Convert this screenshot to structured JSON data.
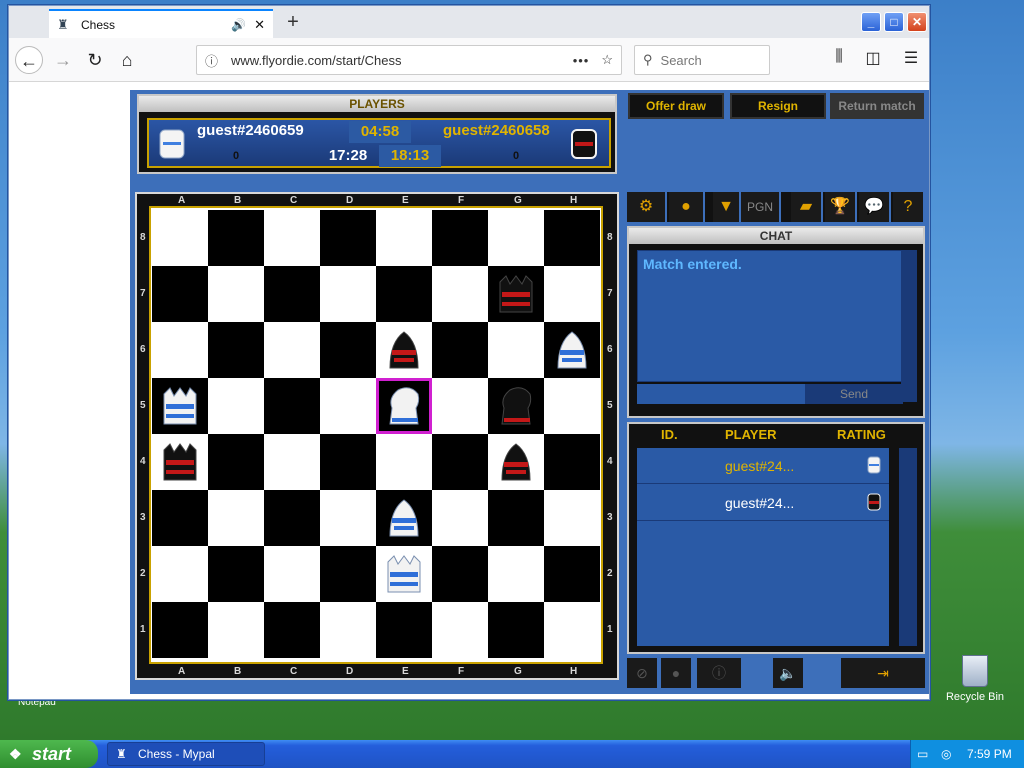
{
  "browser": {
    "tab_title": "Chess",
    "new_tab": "+",
    "url": "www.flyordie.com/start/Chess",
    "search_placeholder": "Search",
    "url_menu": "•••"
  },
  "players_panel": {
    "header": "PLAYERS",
    "player1": {
      "name": "guest#2460659",
      "score": "0"
    },
    "player2": {
      "name": "guest#2460658",
      "score": "0"
    },
    "clock_top": "04:58",
    "clock_p1": "17:28",
    "clock_p2": "18:13"
  },
  "actions": {
    "offer_draw": "Offer draw",
    "resign": "Resign",
    "return_match": "Return match"
  },
  "board": {
    "files": [
      "A",
      "B",
      "C",
      "D",
      "E",
      "F",
      "G",
      "H"
    ],
    "ranks": [
      "8",
      "7",
      "6",
      "5",
      "4",
      "3",
      "2",
      "1"
    ],
    "highlight": "e5",
    "pieces": [
      {
        "square": "g7",
        "piece": "rook",
        "color": "black"
      },
      {
        "square": "e6",
        "piece": "pawn",
        "color": "black"
      },
      {
        "square": "h6",
        "piece": "pawn",
        "color": "white"
      },
      {
        "square": "a5",
        "piece": "rook",
        "color": "white"
      },
      {
        "square": "e5",
        "piece": "knight",
        "color": "white"
      },
      {
        "square": "g5",
        "piece": "knight",
        "color": "black"
      },
      {
        "square": "a4",
        "piece": "rook",
        "color": "black"
      },
      {
        "square": "g4",
        "piece": "pawn",
        "color": "black"
      },
      {
        "square": "e3",
        "piece": "pawn",
        "color": "white"
      },
      {
        "square": "e2",
        "piece": "rook",
        "color": "white"
      }
    ]
  },
  "toolbar": {
    "pgn": "PGN",
    "settings_icon": "gear-icon",
    "dropdown": "▼",
    "help": "?"
  },
  "chat": {
    "header": "CHAT",
    "messages": [
      "Match entered."
    ],
    "send": "Send"
  },
  "player_list": {
    "columns": [
      "ID.",
      "PLAYER",
      "RATING"
    ],
    "rows": [
      {
        "name": "guest#24...",
        "color": "white"
      },
      {
        "name": "guest#24...",
        "color": "black"
      }
    ]
  },
  "desktop": {
    "recycle_bin": "Recycle Bin",
    "notepad": "Notepad"
  },
  "taskbar": {
    "start": "start",
    "task": "Chess - Mypal",
    "clock": "7:59 PM"
  },
  "colors": {
    "gold": "#e0b400",
    "panel_blue": "#2a5aa6",
    "highlight": "#d020d0"
  }
}
